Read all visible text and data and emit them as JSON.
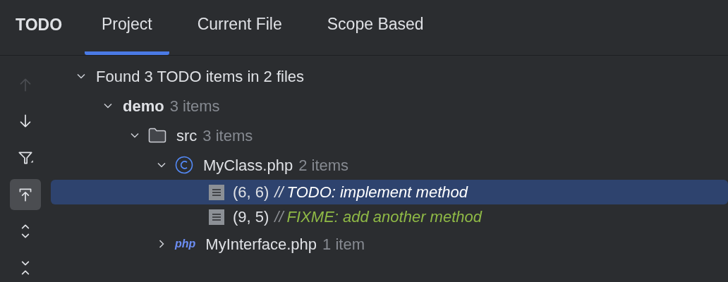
{
  "header": {
    "title": "TODO"
  },
  "tabs": [
    {
      "label": "Project",
      "selected": true
    },
    {
      "label": "Current File",
      "selected": false
    },
    {
      "label": "Scope Based",
      "selected": false
    }
  ],
  "toolbar": [
    {
      "kind": "up",
      "disabled": true,
      "selected": false
    },
    {
      "kind": "down",
      "disabled": false,
      "selected": false
    },
    {
      "kind": "filter",
      "disabled": false,
      "selected": false
    },
    {
      "kind": "autoscroll",
      "disabled": false,
      "selected": true
    },
    {
      "kind": "expand",
      "disabled": false,
      "selected": false
    },
    {
      "kind": "collapse",
      "disabled": false,
      "selected": false
    }
  ],
  "tree": [
    {
      "kind": "summary",
      "label": "Found 3 TODO items in 2 files",
      "expanded": true,
      "children": [
        {
          "kind": "module",
          "label": "demo",
          "count": "3 items",
          "expanded": true,
          "children": [
            {
              "kind": "folder",
              "label": "src",
              "count": "3 items",
              "expanded": true,
              "children": [
                {
                  "kind": "class-file",
                  "label": "MyClass.php",
                  "count": "2 items",
                  "expanded": true,
                  "children": [
                    {
                      "kind": "todo",
                      "position": "(6, 6)",
                      "marker": "//",
                      "text": "TODO: implement method",
                      "selected": true
                    },
                    {
                      "kind": "fixme",
                      "position": "(9, 5)",
                      "marker": "//",
                      "text": "FIXME: add another method",
                      "selected": false
                    }
                  ]
                },
                {
                  "kind": "php-file",
                  "icon_text": "php",
                  "label": "MyInterface.php",
                  "count": "1 item",
                  "expanded": false
                }
              ]
            }
          ]
        }
      ]
    }
  ]
}
